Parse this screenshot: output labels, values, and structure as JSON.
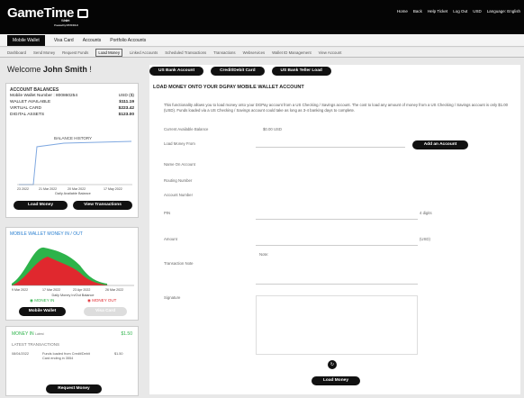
{
  "header": {
    "brand": "GameTime",
    "wallet": "Wallet",
    "powered": "Powered by DPWORLD",
    "nav": [
      "Home",
      "Back",
      "Help Ticket",
      "Log Out",
      "USD",
      "Language: English"
    ]
  },
  "tabs": [
    "Mobile Wallet",
    "Visa Card",
    "Accounts",
    "Portfolio Accounts"
  ],
  "subnav": [
    "Dashboard",
    "Send Money",
    "Request Funds",
    "Load Money",
    "Linked Accounts",
    "Scheduled Transactions",
    "Transactions",
    "Webservices",
    "Wallet ID Management",
    "View Account"
  ],
  "welcome": {
    "prefix": "Welcome ",
    "name": "John Smith",
    "suffix": " !"
  },
  "balances": {
    "title": "ACCOUNT BALANCES",
    "number_label": "Mobile Wallet Number : 800860254",
    "currency": "USD ($)",
    "rows": [
      {
        "label": "WALLET AVAILABLE",
        "value": "$111.19"
      },
      {
        "label": "VIRTUAL CARD",
        "value": "$223.42"
      },
      {
        "label": "DIGITAL ASSETS",
        "value": "$123.00"
      }
    ],
    "chart_title": "BALANCE HISTORY",
    "xlabel": "Daily Available Balance",
    "ticks": [
      "23 2022",
      "21 Mar 2022",
      "20 Mar 2022",
      "17 May 2022"
    ],
    "btn_load": "Load Money",
    "btn_view": "View Transactions"
  },
  "inout": {
    "title": "MOBILE WALLET MONEY IN / OUT",
    "ticks": [
      "9 Mar 2022",
      "17 Mar 2022",
      "23 Apr 2022",
      "26 Mar 2022"
    ],
    "xlabel": "Daily Money In/Out Balance",
    "in": "MONEY IN",
    "out": "MONEY OUT",
    "btn_wallet": "Mobile Wallet",
    "btn_card": "Visa Card"
  },
  "latest": {
    "money_in": "MONEY IN",
    "money_in_sub": "Latest",
    "money_value": "$1.50",
    "title": "LATEST TRANSACTIONS",
    "tx_date": "08/04/2022",
    "tx_desc": "Funds loaded from Credit/Debit Card ending in 3554",
    "tx_amount": "$1.50",
    "btn": "Request Money"
  },
  "main": {
    "tabs": [
      "US Bank Account",
      "Credit/Debit Card",
      "US Bank Teller Load"
    ],
    "heading": "LOAD MONEY ONTO YOUR DGPAY MOBILE WALLET ACCOUNT",
    "para": "This functionality allows you to load money onto your DGPay account from a US Checking / Savings account. The cost to load any amount of money from a US Checking / Savings account is only $1.00 (USD). Funds loaded via a US Checking / Savings account could take as long as 3-4 banking days to complete.",
    "current_label": "Current Available Balance",
    "current_value": "$0.00 USD",
    "load_from": "Load Money From",
    "add_btn": "Add an Account",
    "name_on": "Name On Account",
    "routing": "Routing Number",
    "account": "Account Number",
    "pin": "PIN",
    "pin_hint": "4 digits",
    "amount": "Amount",
    "amount_unit": "(USD)",
    "amount_note": "Note:",
    "trans_note": "Transaction Note",
    "signature": "Signature",
    "submit": "Load Money"
  },
  "chart_data": [
    {
      "type": "line",
      "title": "BALANCE HISTORY",
      "xlabel": "Daily Available Balance",
      "categories": [
        "23 2022",
        "21 Mar 2022",
        "20 Mar 2022",
        "17 May 2022"
      ],
      "series": [
        {
          "values": [
            0,
            120,
            125,
            130
          ]
        }
      ]
    },
    {
      "type": "area",
      "title": "MOBILE WALLET MONEY IN / OUT",
      "xlabel": "Daily Money In/Out Balance",
      "categories": [
        "9 Mar 2022",
        "17 Mar 2022",
        "23 Apr 2022",
        "26 Mar 2022"
      ],
      "series": [
        {
          "name": "MONEY IN",
          "values": [
            5,
            80,
            40,
            0
          ]
        },
        {
          "name": "MONEY OUT",
          "values": [
            3,
            60,
            35,
            0
          ]
        }
      ]
    }
  ],
  "colors": {
    "green": "#2db34a",
    "red": "#e0282e",
    "dark": "#111111"
  }
}
